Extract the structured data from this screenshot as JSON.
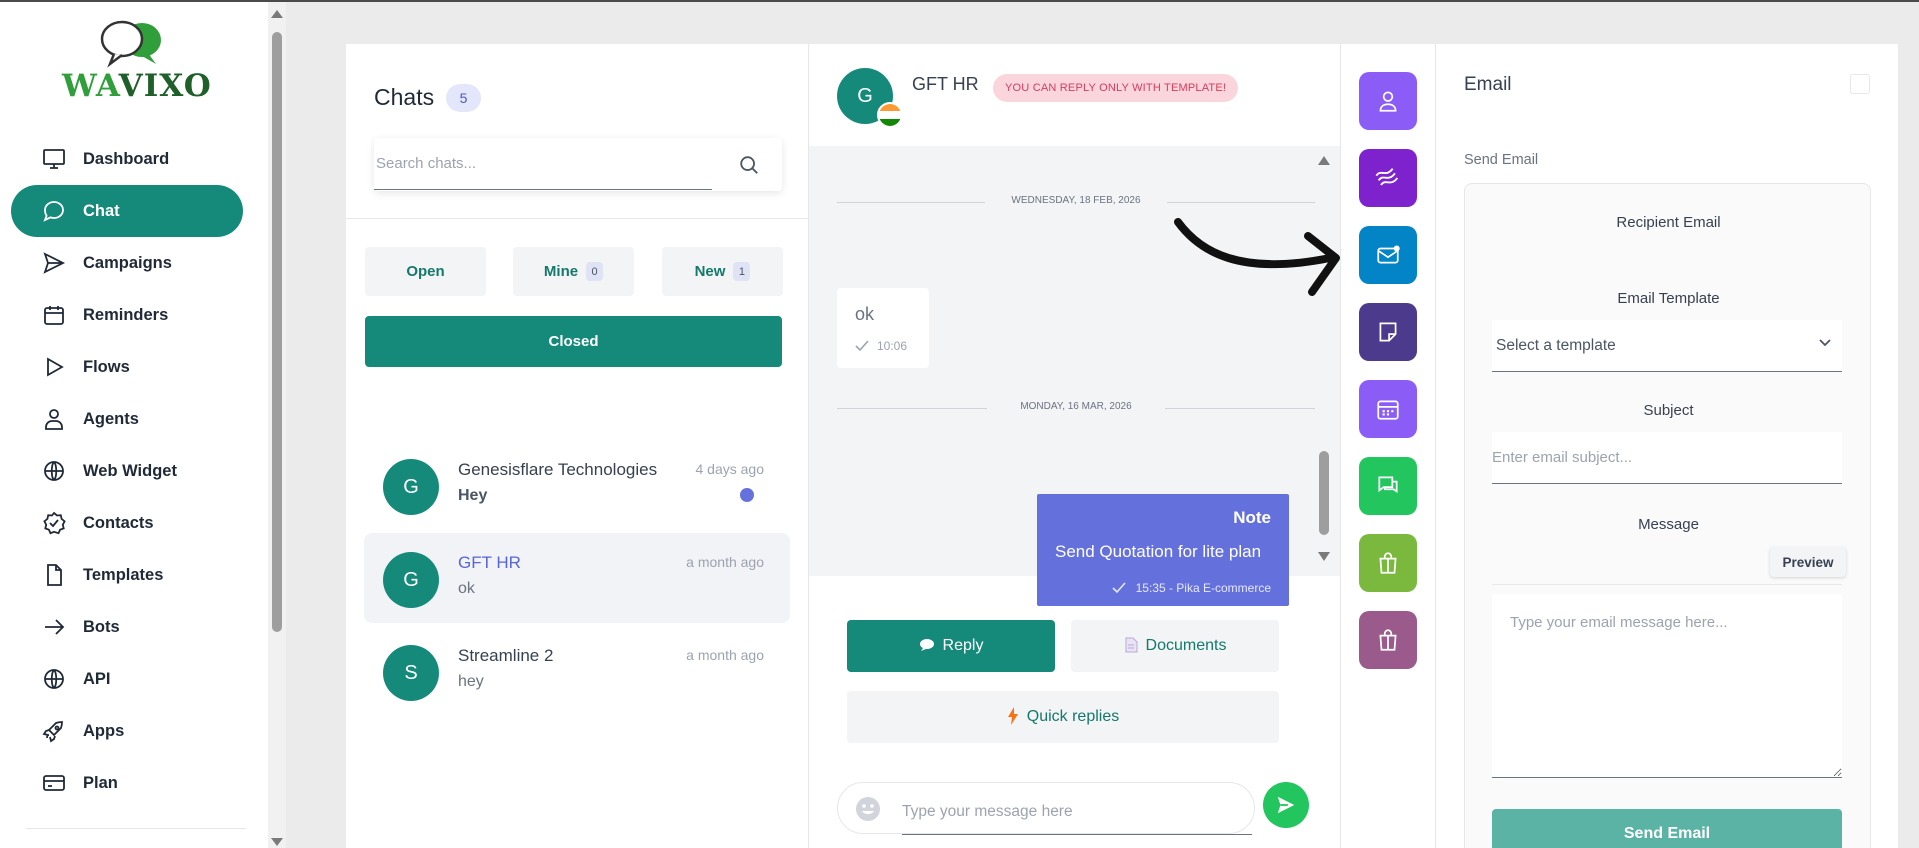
{
  "app": {
    "logo_prefix": "WA",
    "logo_rest": "VIXO"
  },
  "sidebar": {
    "items": [
      {
        "label": "Dashboard",
        "icon": "monitor-icon",
        "active": false
      },
      {
        "label": "Chat",
        "icon": "chat-bubble-icon",
        "active": true
      },
      {
        "label": "Campaigns",
        "icon": "send-icon",
        "active": false
      },
      {
        "label": "Reminders",
        "icon": "calendar-icon",
        "active": false
      },
      {
        "label": "Flows",
        "icon": "play-icon",
        "active": false
      },
      {
        "label": "Agents",
        "icon": "user-icon",
        "active": false
      },
      {
        "label": "Web Widget",
        "icon": "globe-icon",
        "active": false
      },
      {
        "label": "Contacts",
        "icon": "check-circle-icon",
        "active": false
      },
      {
        "label": "Templates",
        "icon": "file-icon",
        "active": false
      },
      {
        "label": "Bots",
        "icon": "arrow-right-icon",
        "active": false
      },
      {
        "label": "API",
        "icon": "globe-icon",
        "active": false
      },
      {
        "label": "Apps",
        "icon": "rocket-icon",
        "active": false
      },
      {
        "label": "Plan",
        "icon": "credit-card-icon",
        "active": false
      }
    ]
  },
  "chatlist": {
    "title": "Chats",
    "count": "5",
    "search_placeholder": "Search chats...",
    "filters": [
      {
        "label": "Open",
        "badge": ""
      },
      {
        "label": "Mine",
        "badge": "0"
      },
      {
        "label": "New",
        "badge": "1"
      }
    ],
    "closed_label": "Closed",
    "conversations": [
      {
        "initial": "G",
        "name": "Genesisflare Technologies",
        "preview": "Hey",
        "time": "4 days ago",
        "unread": true,
        "selected": false
      },
      {
        "initial": "G",
        "name": "GFT HR",
        "preview": "ok",
        "time": "a month ago",
        "unread": false,
        "selected": true
      },
      {
        "initial": "S",
        "name": "Streamline 2",
        "preview": "hey",
        "time": "a month ago",
        "unread": false,
        "selected": false
      }
    ]
  },
  "chat": {
    "initial": "G",
    "name": "GFT HR",
    "notice": "YOU CAN REPLY ONLY WITH TEMPLATE!",
    "date1": "WEDNESDAY, 18 FEB, 2026",
    "msg_in_text": "ok",
    "msg_in_time": "10:06",
    "date2": "MONDAY, 16 MAR, 2026",
    "note_title": "Note",
    "note_body": "Send Quotation for lite plan",
    "note_meta": "15:35 - Pika E-commerce",
    "reply_label": "Reply",
    "documents_label": "Documents",
    "quick_label": "Quick replies",
    "composer_placeholder": "Type your message here"
  },
  "tools": [
    {
      "icon": "user-icon",
      "color": "#8b5cf6"
    },
    {
      "icon": "stripe-icon",
      "color": "#7e22ce"
    },
    {
      "icon": "email-icon",
      "color": "#0284c7"
    },
    {
      "icon": "note-icon",
      "color": "#4c3a8c"
    },
    {
      "icon": "calendar-grid-icon",
      "color": "#8b5cf6"
    },
    {
      "icon": "chat-icon",
      "color": "#22c55e"
    },
    {
      "icon": "shopify-bag-icon",
      "color": "#7ab83e"
    },
    {
      "icon": "shopping-bag-icon",
      "color": "#9b5a8c"
    }
  ],
  "email": {
    "title": "Email",
    "subtitle": "Send Email",
    "recipient_label": "Recipient Email",
    "template_label": "Email Template",
    "template_value": "Select a template",
    "subject_label": "Subject",
    "subject_placeholder": "Enter email subject...",
    "message_label": "Message",
    "preview_label": "Preview",
    "message_placeholder": "Type your email message here...",
    "send_label": "Send Email"
  }
}
